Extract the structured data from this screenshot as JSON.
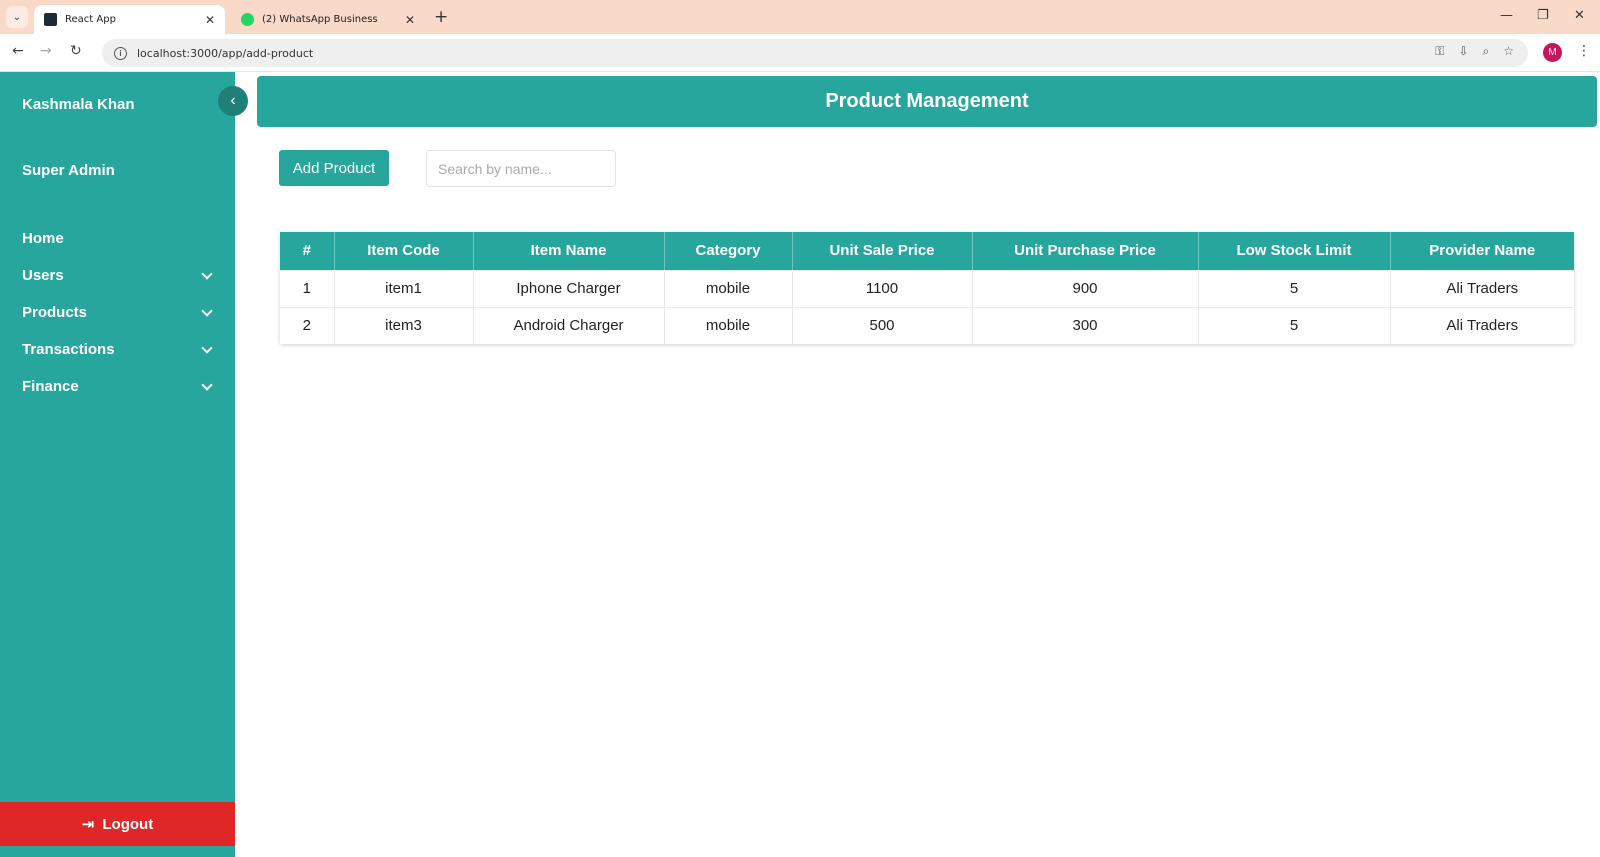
{
  "browser": {
    "tabs": [
      {
        "title": "React App",
        "active": true
      },
      {
        "title": "(2) WhatsApp Business",
        "active": false
      }
    ],
    "url": "localhost:3000/app/add-product"
  },
  "sidebar": {
    "user_name": "Kashmala Khan",
    "role": "Super Admin",
    "items": [
      {
        "label": "Home",
        "has_submenu": false
      },
      {
        "label": "Users",
        "has_submenu": true
      },
      {
        "label": "Products",
        "has_submenu": true
      },
      {
        "label": "Transactions",
        "has_submenu": true
      },
      {
        "label": "Finance",
        "has_submenu": true
      }
    ],
    "logout_label": "Logout"
  },
  "header": {
    "title": "Product Management"
  },
  "actions": {
    "add_label": "Add Product",
    "search_placeholder": "Search by name..."
  },
  "table": {
    "columns": [
      "#",
      "Item Code",
      "Item Name",
      "Category",
      "Unit Sale Price",
      "Unit Purchase Price",
      "Low Stock Limit",
      "Provider Name"
    ],
    "rows": [
      [
        "1",
        "item1",
        "Iphone Charger",
        "mobile",
        "1100",
        "900",
        "5",
        "Ali Traders"
      ],
      [
        "2",
        "item3",
        "Android Charger",
        "mobile",
        "500",
        "300",
        "5",
        "Ali Traders"
      ]
    ]
  },
  "colors": {
    "accent": "#27a69d",
    "logout": "#e02727"
  }
}
